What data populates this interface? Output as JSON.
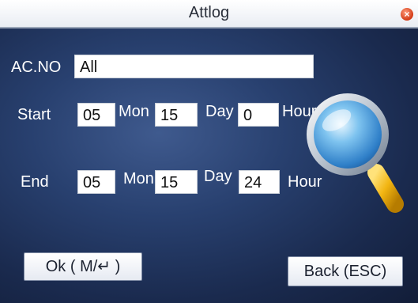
{
  "window": {
    "title": "Attlog"
  },
  "form": {
    "acno_label": "AC.NO",
    "acno_value": "All",
    "start_label": "Start",
    "end_label": "End",
    "mon_label": "Mon",
    "day_label": "Day",
    "hour_label": "Hour",
    "start": {
      "mon": "05",
      "day": "15",
      "hour": "0"
    },
    "end": {
      "mon": "05",
      "day": "15",
      "hour": "24"
    }
  },
  "buttons": {
    "ok_label": "Ok ( M/↵ )",
    "back_label": "Back (ESC)"
  },
  "icons": {
    "close": "close-icon",
    "search": "magnifier-icon"
  },
  "colors": {
    "background": "#28406f",
    "title_bar": "#ffffff",
    "close": "#d23a16",
    "magnifier_handle": "#f2b512"
  }
}
